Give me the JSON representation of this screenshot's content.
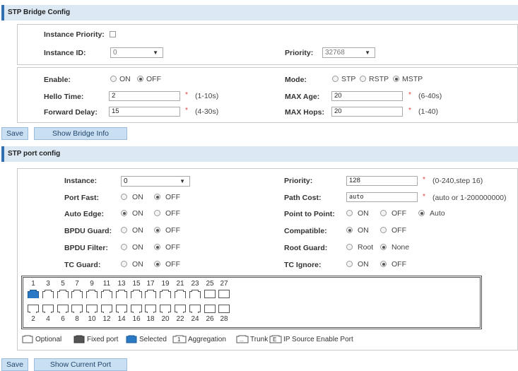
{
  "bridge": {
    "header": "STP Bridge Config",
    "instance_priority_label": "Instance Priority:",
    "instance_id_label": "Instance ID:",
    "instance_id_value": "0",
    "priority_label": "Priority:",
    "priority_value": "32768",
    "enable_label": "Enable:",
    "on": "ON",
    "off": "OFF",
    "mode_label": "Mode:",
    "mode_stp": "STP",
    "mode_rstp": "RSTP",
    "mode_mstp": "MSTP",
    "hello_label": "Hello Time:",
    "hello_value": "2",
    "hello_range": "(1-10s)",
    "maxage_label": "MAX Age:",
    "maxage_value": "20",
    "maxage_range": "(6-40s)",
    "fwd_label": "Forward Delay:",
    "fwd_value": "15",
    "fwd_range": "(4-30s)",
    "maxhops_label": "MAX Hops:",
    "maxhops_value": "20",
    "maxhops_range": "(1-40)",
    "req": "*",
    "save": "Save",
    "show_info": "Show Bridge Info"
  },
  "port": {
    "header": "STP port config",
    "instance_label": "Instance:",
    "instance_value": "0",
    "priority_label": "Priority:",
    "priority_value": "128",
    "priority_range": "(0-240,step 16)",
    "portfast_label": "Port Fast:",
    "pathcost_label": "Path Cost:",
    "pathcost_value": "auto",
    "pathcost_range": "(auto or 1-200000000)",
    "autoedge_label": "Auto Edge:",
    "p2p_label": "Point to Point:",
    "auto": "Auto",
    "bpduguard_label": "BPDU Guard:",
    "compatible_label": "Compatible:",
    "bpdufilter_label": "BPDU Filter:",
    "rootguard_label": "Root Guard:",
    "root": "Root",
    "none": "None",
    "tcguard_label": "TC Guard:",
    "tcignore_label": "TC Ignore:",
    "on": "ON",
    "off": "OFF",
    "top_numbers": [
      "1",
      "3",
      "5",
      "7",
      "9",
      "11",
      "13",
      "15",
      "17",
      "19",
      "21",
      "23",
      "25",
      "27"
    ],
    "bottom_numbers": [
      "2",
      "4",
      "6",
      "8",
      "10",
      "12",
      "14",
      "16",
      "18",
      "20",
      "22",
      "24",
      "26",
      "28"
    ],
    "legend": {
      "optional": "Optional",
      "fixed": "Fixed port",
      "selected": "Selected",
      "aggregation": "Aggregation",
      "trunk": "Trunk",
      "ipsource": "IP Source Enable Port"
    },
    "save": "Save",
    "show_current": "Show Current Port"
  },
  "colors": {
    "header_bg": "#dce9f5",
    "header_accent": "#2f6fb2",
    "selected_port": "#2a79c4",
    "fixed_port": "#555555",
    "button_bg": "#c9dff2"
  }
}
